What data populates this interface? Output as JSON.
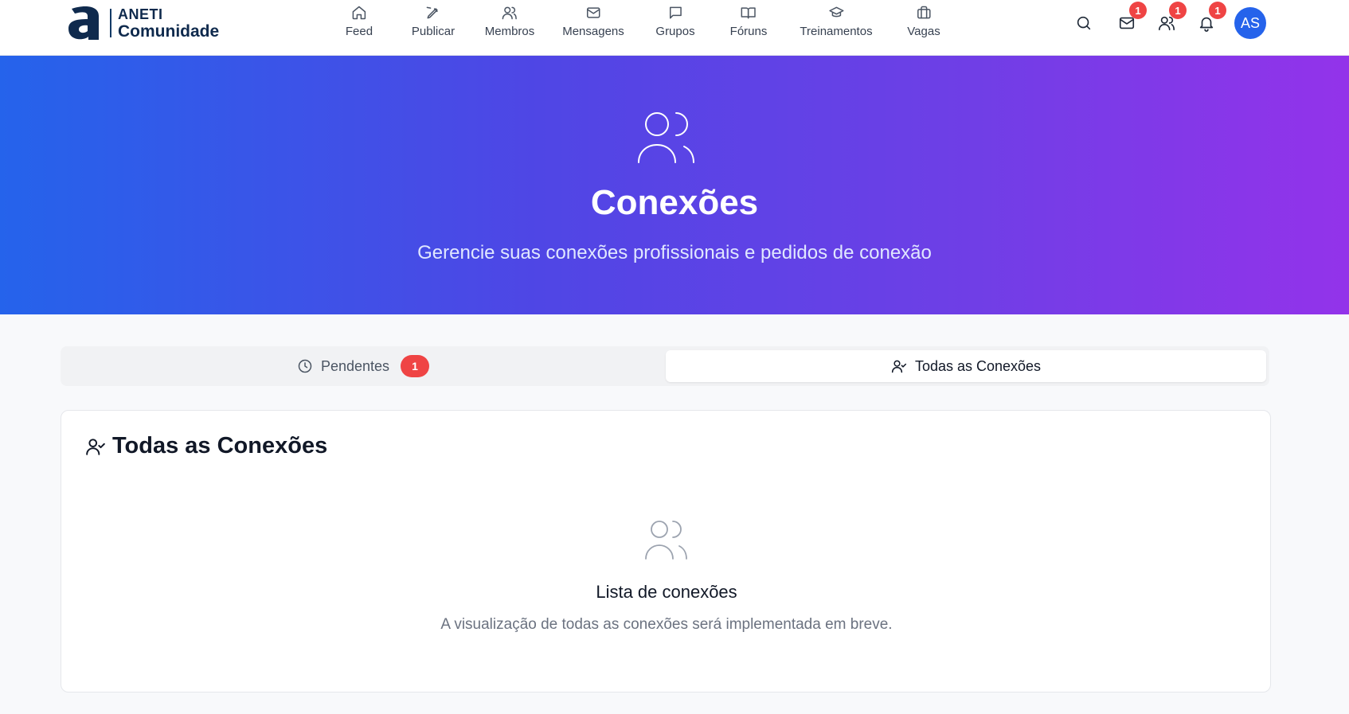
{
  "brand": {
    "line1": "ANETI",
    "line2": "Comunidade"
  },
  "nav": [
    {
      "label": "Feed",
      "icon": "home-icon"
    },
    {
      "label": "Publicar",
      "icon": "pen-icon"
    },
    {
      "label": "Membros",
      "icon": "users-icon"
    },
    {
      "label": "Mensagens",
      "icon": "mail-icon"
    },
    {
      "label": "Grupos",
      "icon": "message-square-icon"
    },
    {
      "label": "Fóruns",
      "icon": "book-open-icon"
    },
    {
      "label": "Treinamentos",
      "icon": "graduation-cap-icon"
    },
    {
      "label": "Vagas",
      "icon": "briefcase-icon"
    }
  ],
  "header_actions": {
    "messages_badge": "1",
    "connections_badge": "1",
    "notifications_badge": "1",
    "avatar_initials": "AS"
  },
  "hero": {
    "title": "Conexões",
    "subtitle": "Gerencie suas conexões profissionais e pedidos de conexão"
  },
  "tabs": [
    {
      "label": "Pendentes",
      "count": "1",
      "icon": "clock-icon"
    },
    {
      "label": "Todas as Conexões",
      "icon": "user-check-icon",
      "active": true
    }
  ],
  "card": {
    "title": "Todas as Conexões",
    "empty_title": "Lista de conexões",
    "empty_description": "A visualização de todas as conexões será implementada em breve."
  },
  "colors": {
    "brand_navy": "#0f2a4d",
    "hero_gradient_start": "#2563eb",
    "hero_gradient_end": "#9333ea",
    "badge_red": "#ef4444",
    "avatar_blue": "#2563eb"
  }
}
